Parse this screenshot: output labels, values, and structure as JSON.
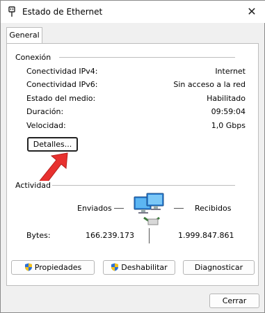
{
  "window": {
    "title": "Estado de Ethernet",
    "close_glyph": "✕"
  },
  "tabs": [
    {
      "label": "General"
    }
  ],
  "connection": {
    "header": "Conexión",
    "rows": [
      {
        "label": "Conectividad IPv4:",
        "value": "Internet"
      },
      {
        "label": "Conectividad IPv6:",
        "value": "Sin acceso a la red"
      },
      {
        "label": "Estado del medio:",
        "value": "Habilitado"
      },
      {
        "label": "Duración:",
        "value": "09:59:04"
      },
      {
        "label": "Velocidad:",
        "value": "1,0 Gbps"
      }
    ],
    "details_button": "Detalles..."
  },
  "activity": {
    "header": "Actividad",
    "sent_label": "Enviados",
    "received_label": "Recibidos",
    "bytes_label": "Bytes:",
    "bytes_sent": "166.239.173",
    "bytes_received": "1.999.847.861"
  },
  "buttons": {
    "properties": "Propiedades",
    "disable": "Deshabilitar",
    "diagnose": "Diagnosticar",
    "close": "Cerrar"
  },
  "colors": {
    "annotation_arrow": "#e8312f",
    "shield_blue": "#2b6fd6",
    "shield_yellow": "#f5c21b"
  }
}
